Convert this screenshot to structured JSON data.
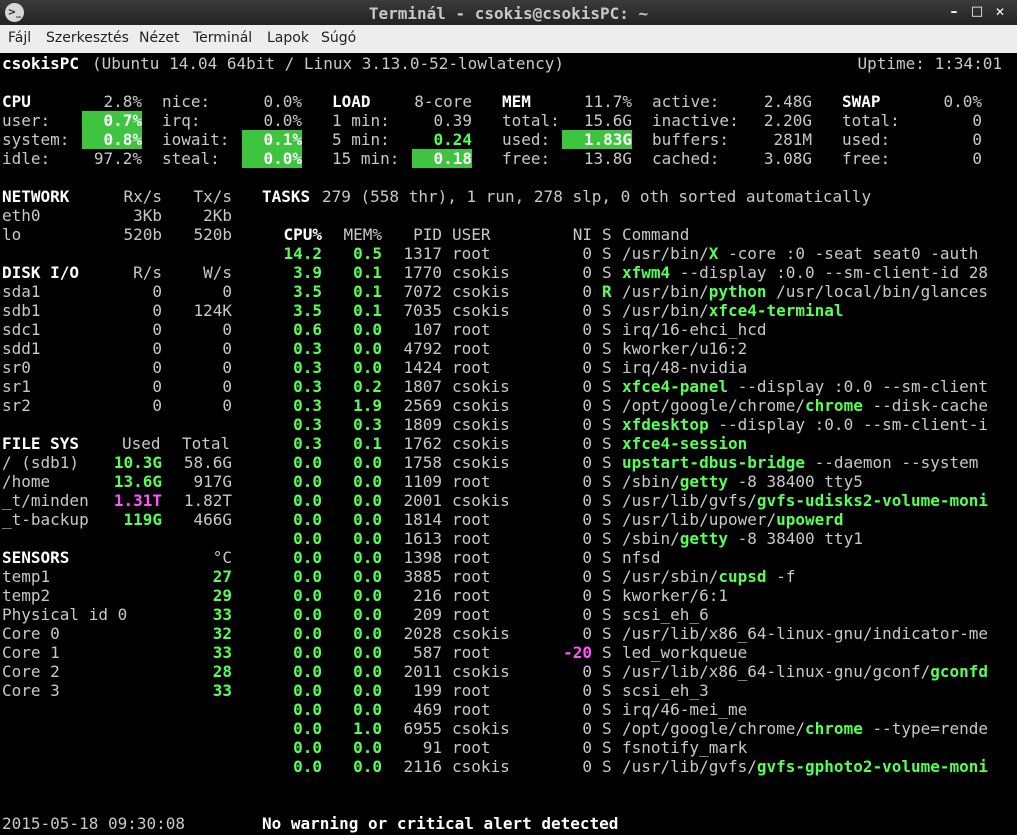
{
  "window": {
    "title": "Terminál - csokis@csokisPC: ~",
    "icon": "terminal-icon",
    "min": "–",
    "max": "□",
    "close": "✕"
  },
  "menu": [
    "Fájl",
    "Szerkesztés",
    "Nézet",
    "Terminál",
    "Lapok",
    "Súgó"
  ],
  "header": {
    "host": "csokisPC",
    "info": "(Ubuntu 14.04 64bit / Linux 3.13.0-52-lowlatency)",
    "uptime": "Uptime: 1:34:01"
  },
  "cpu": {
    "title": "CPU",
    "total": "2.8%",
    "user_l": "user:",
    "user": "0.7%",
    "system_l": "system:",
    "system": "0.8%",
    "idle_l": "idle:",
    "idle": "97.2%",
    "nice_l": "nice:",
    "nice": "0.0%",
    "irq_l": "irq:",
    "irq": "0.0%",
    "iowait_l": "iowait:",
    "iowait": "0.1%",
    "steal_l": "steal:",
    "steal": "0.0%"
  },
  "load": {
    "title": "LOAD",
    "cores": "8-core",
    "m1_l": "1 min:",
    "m1": "0.39",
    "m5_l": "5 min:",
    "m5": "0.24",
    "m15_l": "15 min:",
    "m15": "0.18"
  },
  "mem": {
    "title": "MEM",
    "pct": "11.7%",
    "total_l": "total:",
    "total": "15.6G",
    "used_l": "used:",
    "used": "1.83G",
    "free_l": "free:",
    "free": "13.8G",
    "active_l": "active:",
    "active": "2.48G",
    "inactive_l": "inactive:",
    "inactive": "2.20G",
    "buffers_l": "buffers:",
    "buffers": "281M",
    "cached_l": "cached:",
    "cached": "3.08G"
  },
  "swap": {
    "title": "SWAP",
    "pct": "0.0%",
    "total_l": "total:",
    "total": "0",
    "used_l": "used:",
    "used": "0",
    "free_l": "free:",
    "free": "0"
  },
  "network": {
    "title": "NETWORK",
    "rx": "Rx/s",
    "tx": "Tx/s",
    "rows": [
      [
        "eth0",
        "3Kb",
        "2Kb"
      ],
      [
        "lo",
        "520b",
        "520b"
      ]
    ]
  },
  "disk": {
    "title": "DISK I/O",
    "r": "R/s",
    "w": "W/s",
    "rows": [
      [
        "sda1",
        "0",
        "0"
      ],
      [
        "sdb1",
        "0",
        "124K"
      ],
      [
        "sdc1",
        "0",
        "0"
      ],
      [
        "sdd1",
        "0",
        "0"
      ],
      [
        "sr0",
        "0",
        "0"
      ],
      [
        "sr1",
        "0",
        "0"
      ],
      [
        "sr2",
        "0",
        "0"
      ]
    ]
  },
  "fs": {
    "title": "FILE SYS",
    "used": "Used",
    "total": "Total",
    "rows": [
      [
        "/ (sdb1)",
        "10.3G",
        "58.6G"
      ],
      [
        "/home",
        "13.6G",
        "917G"
      ],
      [
        "_t/minden",
        "1.31T",
        "1.82T"
      ],
      [
        "_t-backup",
        "119G",
        "466G"
      ]
    ]
  },
  "sensors": {
    "title": "SENSORS",
    "unit": "°C",
    "rows": [
      [
        "temp1",
        "27"
      ],
      [
        "temp2",
        "29"
      ],
      [
        "Physical id 0",
        "33"
      ],
      [
        "Core 0",
        "32"
      ],
      [
        "Core 1",
        "33"
      ],
      [
        "Core 2",
        "28"
      ],
      [
        "Core 3",
        "33"
      ]
    ]
  },
  "tasks": {
    "title": "TASKS",
    "summary": "279 (558 thr), 1 run, 278 slp, 0 oth sorted automatically"
  },
  "proc_header": {
    "cpu": "CPU%",
    "mem": "MEM%",
    "pid": "PID",
    "user": "USER",
    "ni": "NI",
    "s": "S",
    "cmd": "Command"
  },
  "procs": [
    [
      "14.2",
      "0.5",
      "1317",
      "root",
      "0",
      "S",
      "/usr/bin/",
      "X",
      " -core :0 -seat seat0 -auth"
    ],
    [
      "3.9",
      "0.1",
      "1770",
      "csokis",
      "0",
      "S",
      "",
      "xfwm4",
      " --display :0.0 --sm-client-id 28"
    ],
    [
      "3.5",
      "0.1",
      "7072",
      "csokis",
      "0",
      "R",
      "/usr/bin/",
      "python",
      " /usr/local/bin/glances"
    ],
    [
      "3.5",
      "0.1",
      "7035",
      "csokis",
      "0",
      "S",
      "/usr/bin/",
      "xfce4-terminal",
      ""
    ],
    [
      "0.6",
      "0.0",
      "107",
      "root",
      "0",
      "S",
      "irq/16-ehci_hcd",
      "",
      ""
    ],
    [
      "0.3",
      "0.0",
      "4792",
      "root",
      "0",
      "S",
      "kworker/u16:2",
      "",
      ""
    ],
    [
      "0.3",
      "0.0",
      "1424",
      "root",
      "0",
      "S",
      "irq/48-nvidia",
      "",
      ""
    ],
    [
      "0.3",
      "0.2",
      "1807",
      "csokis",
      "0",
      "S",
      "",
      "xfce4-panel",
      " --display :0.0 --sm-client"
    ],
    [
      "0.3",
      "1.9",
      "2569",
      "csokis",
      "0",
      "S",
      "/opt/google/chrome/",
      "chrome",
      " --disk-cache"
    ],
    [
      "0.3",
      "0.3",
      "1809",
      "csokis",
      "0",
      "S",
      "",
      "xfdesktop",
      " --display :0.0 --sm-client-i"
    ],
    [
      "0.3",
      "0.1",
      "1762",
      "csokis",
      "0",
      "S",
      "",
      "xfce4-session",
      ""
    ],
    [
      "0.0",
      "0.0",
      "1758",
      "csokis",
      "0",
      "S",
      "",
      "upstart-dbus-bridge",
      " --daemon --system"
    ],
    [
      "0.0",
      "0.0",
      "1109",
      "root",
      "0",
      "S",
      "/sbin/",
      "getty",
      " -8 38400 tty5"
    ],
    [
      "0.0",
      "0.0",
      "2001",
      "csokis",
      "0",
      "S",
      "/usr/lib/gvfs/",
      "gvfs-udisks2-volume-moni",
      ""
    ],
    [
      "0.0",
      "0.0",
      "1814",
      "root",
      "0",
      "S",
      "/usr/lib/upower/",
      "upowerd",
      ""
    ],
    [
      "0.0",
      "0.0",
      "1613",
      "root",
      "0",
      "S",
      "/sbin/",
      "getty",
      " -8 38400 tty1"
    ],
    [
      "0.0",
      "0.0",
      "1398",
      "root",
      "0",
      "S",
      "nfsd",
      "",
      ""
    ],
    [
      "0.0",
      "0.0",
      "3885",
      "root",
      "0",
      "S",
      "/usr/sbin/",
      "cupsd",
      " -f"
    ],
    [
      "0.0",
      "0.0",
      "216",
      "root",
      "0",
      "S",
      "kworker/6:1",
      "",
      ""
    ],
    [
      "0.0",
      "0.0",
      "209",
      "root",
      "0",
      "S",
      "scsi_eh_6",
      "",
      ""
    ],
    [
      "0.0",
      "0.0",
      "2028",
      "csokis",
      "0",
      "S",
      "/usr/lib/x86_64-linux-gnu/indicator-me",
      "",
      ""
    ],
    [
      "0.0",
      "0.0",
      "587",
      "root",
      "-20",
      "S",
      "led_workqueue",
      "",
      ""
    ],
    [
      "0.0",
      "0.0",
      "2011",
      "csokis",
      "0",
      "S",
      "/usr/lib/x86_64-linux-gnu/gconf/",
      "gconfd",
      ""
    ],
    [
      "0.0",
      "0.0",
      "199",
      "root",
      "0",
      "S",
      "scsi_eh_3",
      "",
      ""
    ],
    [
      "0.0",
      "0.0",
      "469",
      "root",
      "0",
      "S",
      "irq/46-mei_me",
      "",
      ""
    ],
    [
      "0.0",
      "1.0",
      "6955",
      "csokis",
      "0",
      "S",
      "/opt/google/chrome/",
      "chrome",
      " --type=rende"
    ],
    [
      "0.0",
      "0.0",
      "91",
      "root",
      "0",
      "S",
      "fsnotify_mark",
      "",
      ""
    ],
    [
      "0.0",
      "0.0",
      "2116",
      "csokis",
      "0",
      "S",
      "/usr/lib/gvfs/",
      "gvfs-gphoto2-volume-moni",
      ""
    ]
  ],
  "footer": {
    "datetime": "2015-05-18 09:30:08",
    "alert": "No warning or critical alert detected"
  },
  "colors": {
    "highlight": "#3ec43e",
    "bright_green": "#55ff55",
    "magenta": "#ff55ff"
  }
}
